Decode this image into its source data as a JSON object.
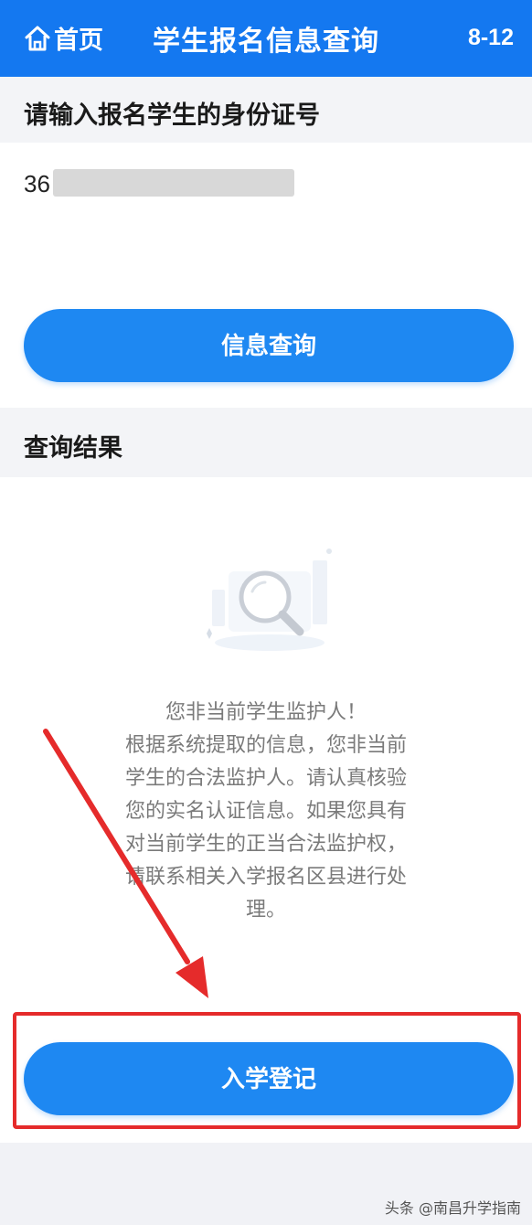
{
  "header": {
    "home_label": "首页",
    "title": "学生报名信息查询",
    "meta": "8-12"
  },
  "id_section": {
    "label": "请输入报名学生的身份证号",
    "id_value_prefix": "36"
  },
  "query_button": {
    "label": "信息查询"
  },
  "result_section": {
    "label": "查询结果",
    "message_lines": [
      "您非当前学生监护人！",
      "根据系统提取的信息，您非当前",
      "学生的合法监护人。请认真核验",
      "您的实名认证信息。如果您具有",
      "对当前学生的正当合法监护权，",
      "请联系相关入学报名区县进行处",
      "理。"
    ]
  },
  "register_button": {
    "label": "入学登记"
  },
  "watermark": {
    "text": "头条 @南昌升学指南"
  },
  "colors": {
    "header_bg": "#1478f0",
    "button_bg": "#1e88f2",
    "annotation_red": "#e52b2b"
  },
  "icons": [
    "home-icon",
    "magnifier-icon"
  ]
}
